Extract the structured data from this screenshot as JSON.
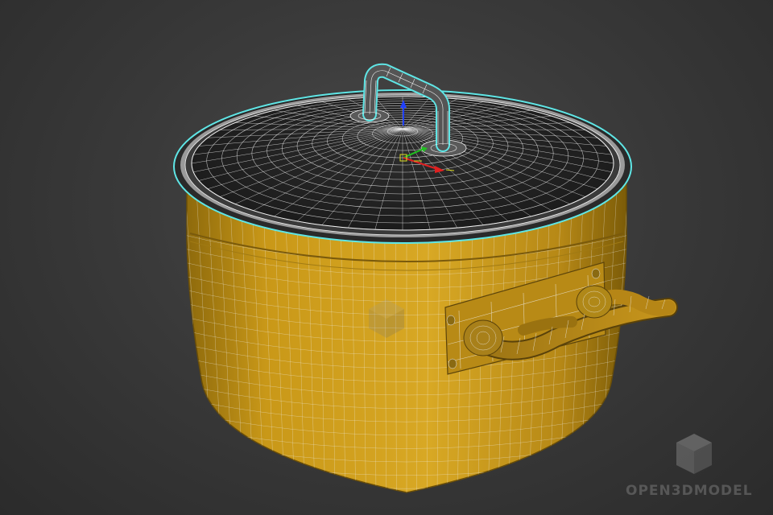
{
  "viewport": {
    "background_color": "#3a3a3a",
    "wire_color": "#f2f2f2",
    "pot_color": "#d4a21b",
    "selection_outline_color": "#5fe6e6"
  },
  "object": {
    "description_icons": [
      "pot-icon",
      "lid-icon",
      "handle-icon"
    ]
  },
  "gizmo": {
    "axis_colors": {
      "x": "#e02020",
      "y": "#20c020",
      "z": "#2040ff"
    },
    "icon": "transform-gizmo-icon"
  },
  "watermark": {
    "brand_text": "OPEN3DMODEL",
    "icon": "cube-logo-icon",
    "color": "#7a7a7a"
  }
}
